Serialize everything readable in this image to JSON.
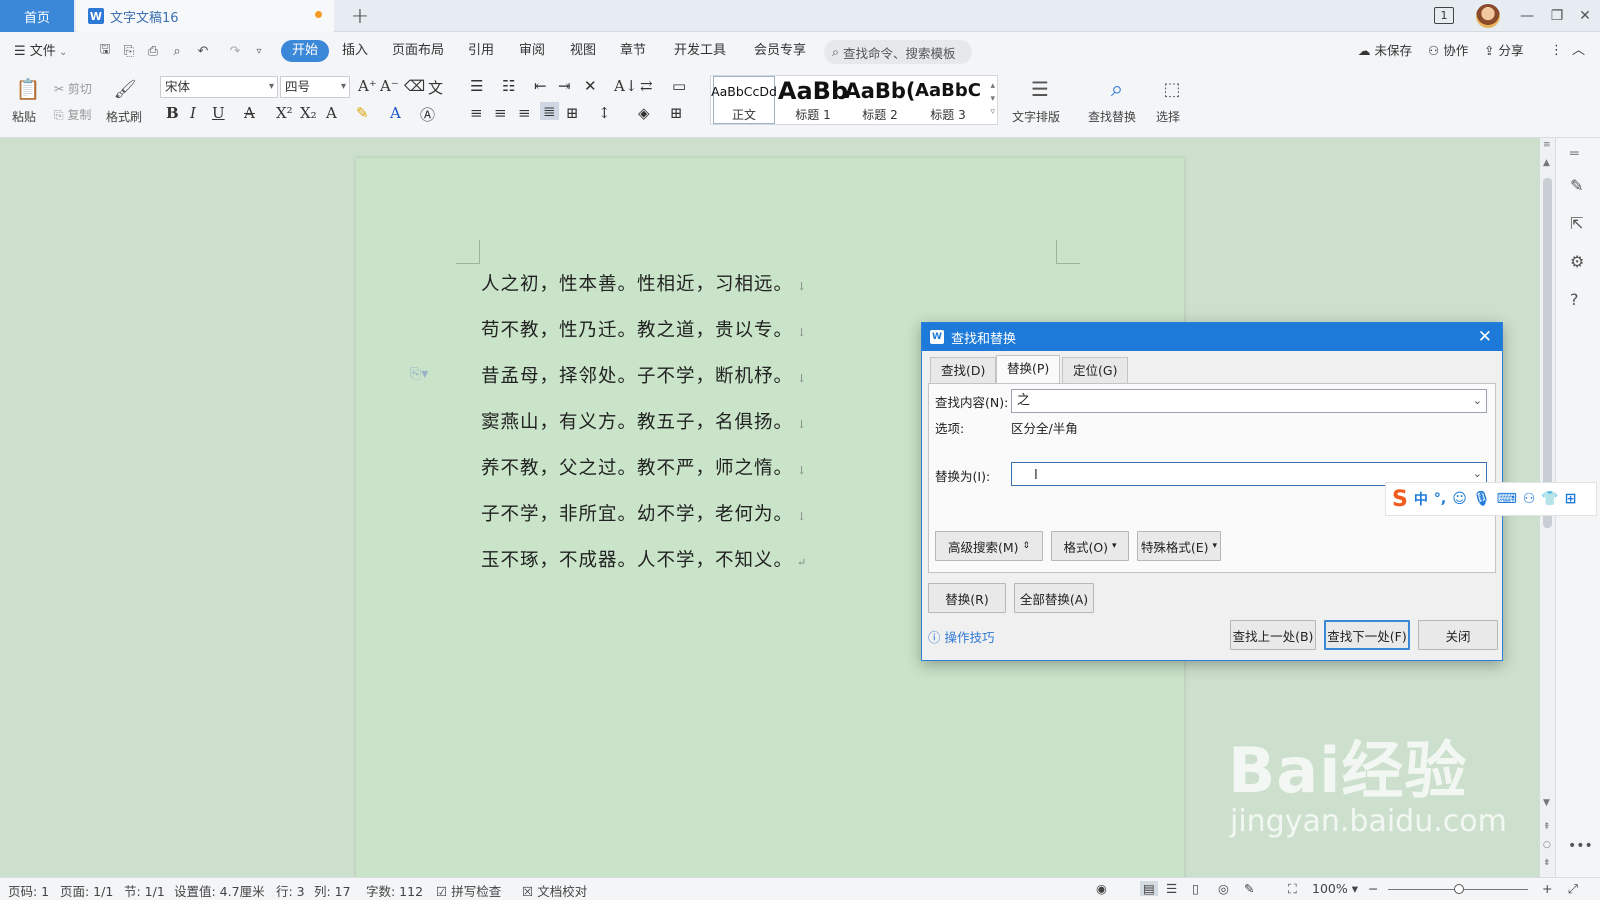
{
  "tabs": {
    "home": "首页",
    "doc": "文字文稿16",
    "new": "+",
    "page_badge": "1"
  },
  "menu": {
    "file": "文件",
    "items": [
      "开始",
      "插入",
      "页面布局",
      "引用",
      "审阅",
      "视图",
      "章节",
      "开发工具",
      "会员专享"
    ],
    "active": "开始",
    "search_placeholder": "查找命令、搜索模板",
    "unsaved": "未保存",
    "collab": "协作",
    "share": "分享"
  },
  "ribbon": {
    "paste": "粘贴",
    "cut": "剪切",
    "copy": "复制",
    "format_painter": "格式刷",
    "font_name": "宋体",
    "font_size": "四号",
    "styles": [
      {
        "preview": "AaBbCcDd",
        "name": "正文"
      },
      {
        "preview": "AaBb",
        "name": "标题 1"
      },
      {
        "preview": "AaBb(",
        "name": "标题 2"
      },
      {
        "preview": "AaBbC",
        "name": "标题 3"
      }
    ],
    "text_layout": "文字排版",
    "find_replace": "查找替换",
    "select": "选择"
  },
  "document": {
    "lines": [
      "人之初，性本善。性相近，习相远。",
      "苟不教，性乃迁。教之道，贵以专。",
      "昔孟母，择邻处。子不学，断机杼。",
      "窦燕山，有义方。教五子，名俱扬。",
      "养不教，父之过。教不严，师之惰。",
      "子不学，非所宜。幼不学，老何为。",
      "玉不琢，不成器。人不学，不知义。"
    ]
  },
  "dialog": {
    "title": "查找和替换",
    "tabs": [
      "查找(D)",
      "替换(P)",
      "定位(G)"
    ],
    "active_tab": "替换(P)",
    "find_label": "查找内容(N):",
    "find_value": "之",
    "options_label": "选项:",
    "options_value": "区分全/半角",
    "replace_label": "替换为(I):",
    "replace_value": "",
    "btn_advanced": "高级搜索(M)",
    "btn_format": "格式(O)",
    "btn_special": "特殊格式(E)",
    "btn_replace": "替换(R)",
    "btn_replace_all": "全部替换(A)",
    "tips": "操作技巧",
    "btn_find_prev": "查找上一处(B)",
    "btn_find_next": "查找下一处(F)",
    "btn_close": "关闭"
  },
  "ime": {
    "mode": "中"
  },
  "status": {
    "page_code": "页码: 1",
    "pages": "页面: 1/1",
    "section": "节: 1/1",
    "setting": "设置值: 4.7厘米",
    "row": "行: 3",
    "col": "列: 17",
    "word_count": "字数: 112",
    "spell_check": "拼写检查",
    "doc_check": "文档校对",
    "zoom": "100%"
  },
  "watermark": {
    "big": "Bai经验",
    "small": "jingyan.baidu.com"
  }
}
